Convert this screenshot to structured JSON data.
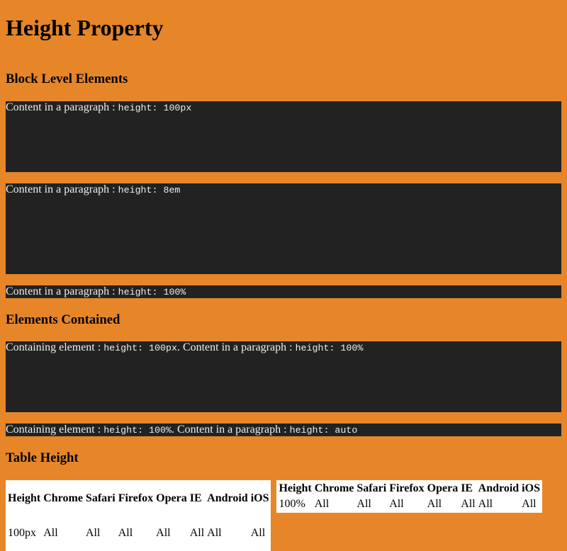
{
  "page": {
    "title": "Height Property",
    "sections": {
      "block": {
        "heading": "Block Level Elements",
        "boxes": [
          {
            "label": "Content in a paragraph : ",
            "code": "height: 100px"
          },
          {
            "label": "Content in a paragraph : ",
            "code": "height: 8em"
          },
          {
            "label": "Content in a paragraph : ",
            "code": "height: 100%"
          }
        ]
      },
      "contained": {
        "heading": "Elements Contained",
        "boxes": [
          {
            "label1": "Containing element : ",
            "code1": "height: 100px",
            "label2": ". Content in a paragraph : ",
            "code2": "height: 100%"
          },
          {
            "label1": "Containing element : ",
            "code1": "height: 100%",
            "label2": ". Content in a paragraph : ",
            "code2": "height: auto"
          }
        ]
      },
      "table": {
        "heading": "Table Height",
        "headers": [
          "Height",
          "Chrome",
          "Safari",
          "Firefox",
          "Opera",
          "IE",
          "Android",
          "iOS"
        ],
        "tables": [
          {
            "row": [
              "100px",
              "All",
              "All",
              "All",
              "All",
              "All",
              "All",
              "All"
            ]
          },
          {
            "row": [
              "100%",
              "All",
              "All",
              "All",
              "All",
              "All",
              "All",
              "All"
            ]
          }
        ]
      }
    }
  },
  "colors": {
    "background": "#e68628",
    "box": "#222222",
    "box_text": "#eeeeee",
    "table_bg": "#ffffff"
  }
}
